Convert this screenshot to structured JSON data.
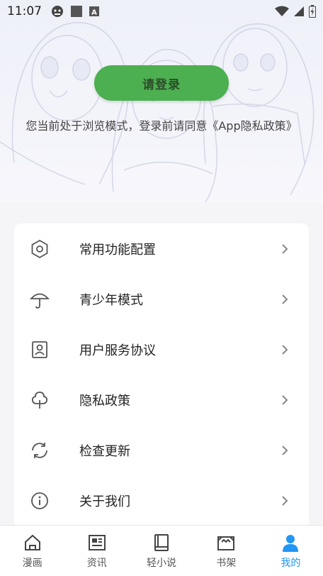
{
  "status_bar": {
    "time": "11:07",
    "left_icons": [
      "game-icon",
      "square-icon",
      "notification-a-icon"
    ],
    "right_icons": [
      "wifi-icon",
      "signal-icon",
      "battery-charging-icon"
    ]
  },
  "header": {
    "login_button": "请登录",
    "browse_notice": "您当前处于浏览模式，登录前请同意《App隐私政策》"
  },
  "menu": {
    "items": [
      {
        "label": "常用功能配置",
        "icon": "hexagon-settings-icon"
      },
      {
        "label": "青少年模式",
        "icon": "umbrella-icon"
      },
      {
        "label": "用户服务协议",
        "icon": "user-card-icon"
      },
      {
        "label": "隐私政策",
        "icon": "tree-icon"
      },
      {
        "label": "检查更新",
        "icon": "refresh-icon"
      },
      {
        "label": "关于我们",
        "icon": "info-icon"
      }
    ]
  },
  "bottom_nav": {
    "tabs": [
      {
        "label": "漫画",
        "icon": "home-icon",
        "active": false
      },
      {
        "label": "资讯",
        "icon": "news-icon",
        "active": false
      },
      {
        "label": "轻小说",
        "icon": "book-icon",
        "active": false
      },
      {
        "label": "书架",
        "icon": "bookshelf-icon",
        "active": false
      },
      {
        "label": "我的",
        "icon": "profile-icon",
        "active": true
      }
    ]
  },
  "colors": {
    "accent": "#2196f3",
    "login_button": "#4caf50",
    "background": "#f5f5f7"
  }
}
